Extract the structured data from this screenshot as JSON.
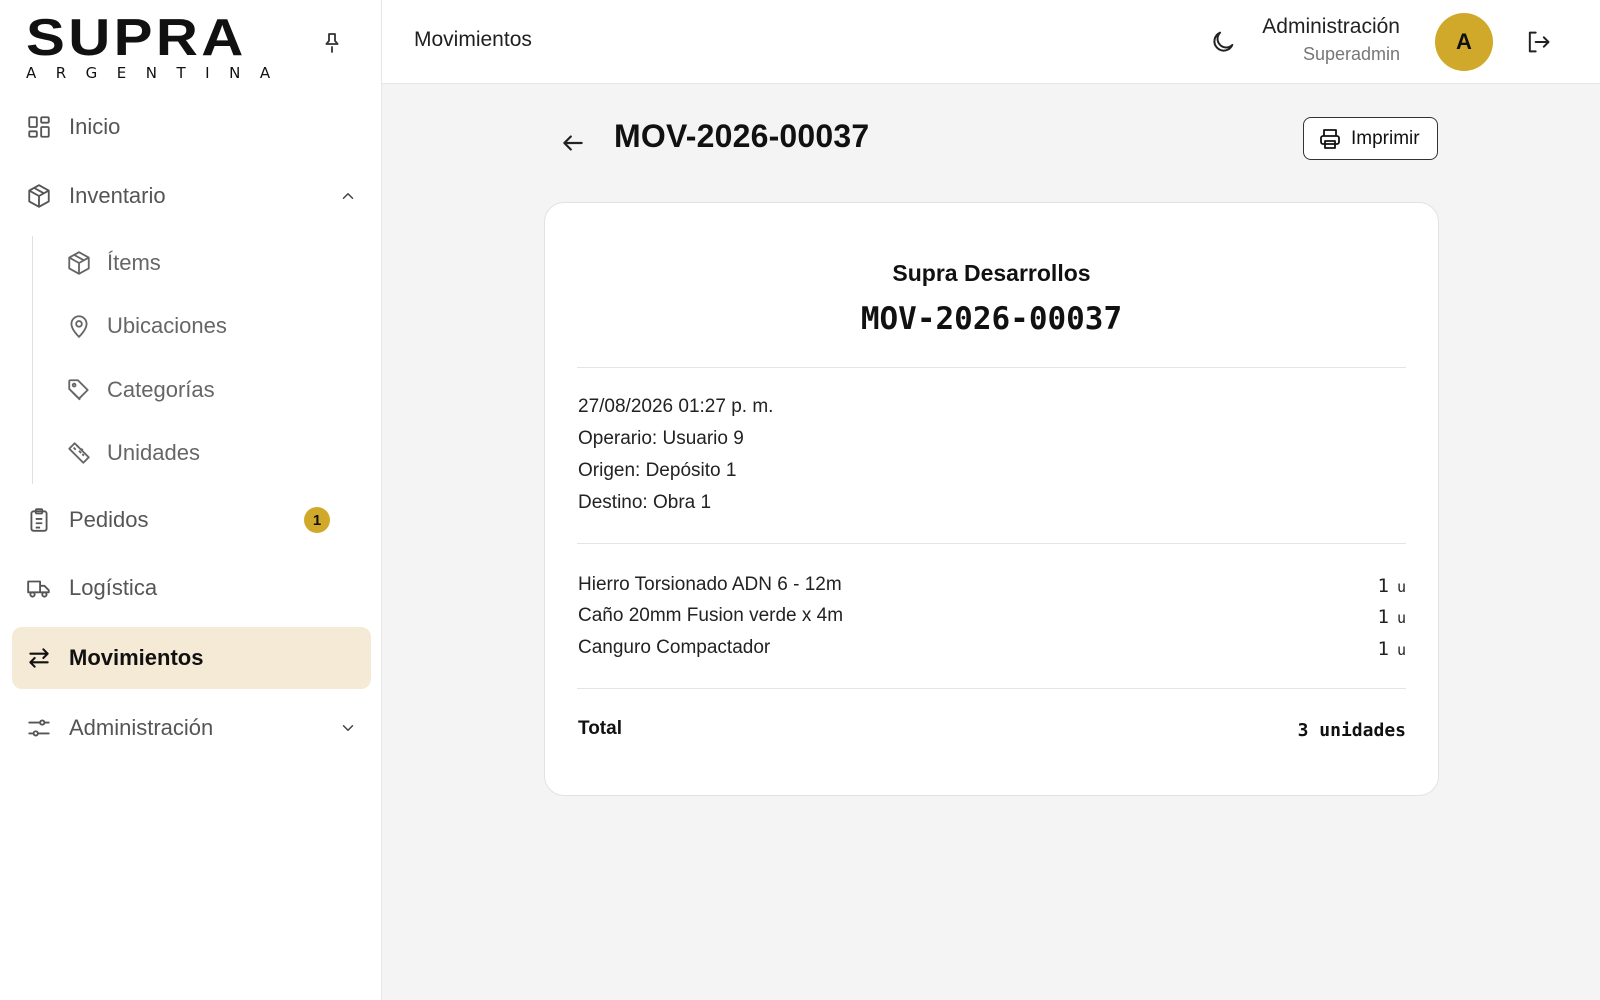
{
  "brand": {
    "name": "SUPRA",
    "subtitle": "ARGENTINA"
  },
  "sidebar": {
    "items": [
      {
        "label": "Inicio",
        "icon": "dashboard-icon"
      },
      {
        "label": "Inventario",
        "icon": "box-icon",
        "expanded": true
      },
      {
        "label": "Pedidos",
        "icon": "clipboard-icon",
        "badge": "1"
      },
      {
        "label": "Logística",
        "icon": "truck-icon"
      },
      {
        "label": "Movimientos",
        "icon": "arrows-swap-icon",
        "active": true
      },
      {
        "label": "Administración",
        "icon": "sliders-icon",
        "expanded": false
      }
    ],
    "inventory_subitems": [
      {
        "label": "Ítems",
        "icon": "box-icon"
      },
      {
        "label": "Ubicaciones",
        "icon": "map-pin-icon"
      },
      {
        "label": "Categorías",
        "icon": "tags-icon"
      },
      {
        "label": "Unidades",
        "icon": "ruler-icon"
      }
    ]
  },
  "header": {
    "title": "Movimientos",
    "user_name": "Administración",
    "user_role": "Superadmin",
    "avatar_initial": "A"
  },
  "page": {
    "title": "MOV-2026-00037",
    "print_label": "Imprimir"
  },
  "receipt": {
    "company": "Supra Desarrollos",
    "code": "MOV-2026-00037",
    "datetime": "27/08/2026 01:27 p. m.",
    "operator": "Operario: Usuario 9",
    "origin": "Origen: Depósito 1",
    "destination": "Destino: Obra 1",
    "items": [
      {
        "name": "Hierro Torsionado ADN 6 - 12m",
        "qty": "1",
        "unit": "u"
      },
      {
        "name": "Caño 20mm Fusion verde x 4m",
        "qty": "1",
        "unit": "u"
      },
      {
        "name": "Canguro Compactador",
        "qty": "1",
        "unit": "u"
      }
    ],
    "total_label": "Total",
    "total_value": "3 unidades"
  },
  "colors": {
    "accent": "#d1a92a",
    "active_bg": "#f4ead5",
    "background": "#f4f4f4"
  }
}
